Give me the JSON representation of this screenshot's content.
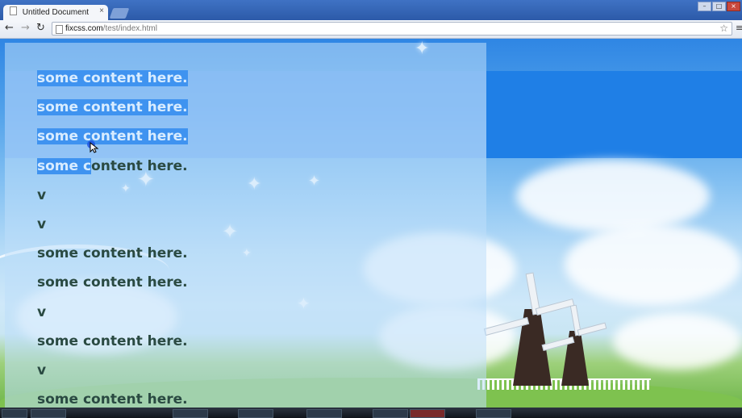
{
  "browser": {
    "tab_title": "Untitled Document",
    "tab_close": "×",
    "back": "←",
    "forward": "→",
    "reload": "↻",
    "url_host": "fixcss.com",
    "url_path": "/test/index.html",
    "star": "☆",
    "menu": "≡",
    "win_min": "–",
    "win_max": "□",
    "win_close": "×"
  },
  "page": {
    "lines": [
      "some content here.",
      "some content here.",
      "some content here.",
      "some content here.",
      "v",
      "v",
      "some content here.",
      "some content here.",
      "v",
      "some content here.",
      "v",
      "some content here."
    ],
    "line4_selected_part": "some c",
    "line4_rest": "ontent here."
  },
  "colors": {
    "selection": "#3f93f0",
    "text": "#2a4a42",
    "sky": "#2f86e4"
  }
}
